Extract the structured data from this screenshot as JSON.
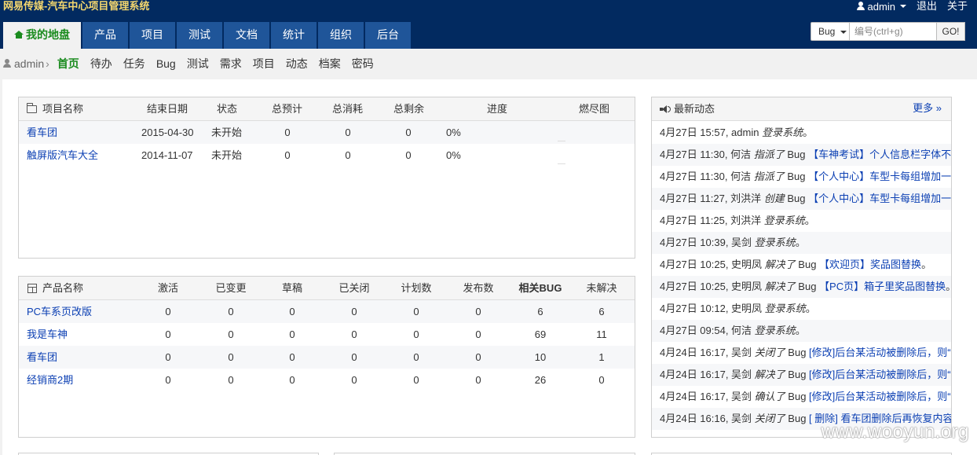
{
  "app_title": "网易传媒-汽车中心项目管理系统",
  "top_right": {
    "user": "admin",
    "logout": "退出",
    "about": "关于"
  },
  "main_nav": [
    "我的地盘",
    "产品",
    "项目",
    "测试",
    "文档",
    "统计",
    "组织",
    "后台"
  ],
  "search": {
    "type": "Bug",
    "placeholder": "编号(ctrl+g)",
    "go": "GO!"
  },
  "sub_nav": {
    "user": "admin",
    "items": [
      "首页",
      "待办",
      "任务",
      "Bug",
      "测试",
      "需求",
      "项目",
      "动态",
      "档案",
      "密码"
    ]
  },
  "project_panel": {
    "headers": [
      "项目名称",
      "结束日期",
      "状态",
      "总预计",
      "总消耗",
      "总剩余",
      "进度",
      "燃尽图"
    ],
    "rows": [
      {
        "name": "看车团",
        "end": "2015-04-30",
        "status": "未开始",
        "estimate": "0",
        "consumed": "0",
        "left": "0",
        "progress": "0%"
      },
      {
        "name": "触屏版汽车大全",
        "end": "2014-11-07",
        "status": "未开始",
        "estimate": "0",
        "consumed": "0",
        "left": "0",
        "progress": "0%"
      }
    ]
  },
  "product_panel": {
    "headers": [
      "产品名称",
      "激活",
      "已变更",
      "草稿",
      "已关闭",
      "计划数",
      "发布数",
      "相关BUG",
      "未解决"
    ],
    "rows": [
      {
        "name": "PC车系页改版",
        "vals": [
          "0",
          "0",
          "0",
          "0",
          "0",
          "0",
          "6",
          "6"
        ]
      },
      {
        "name": "我是车神",
        "vals": [
          "0",
          "0",
          "0",
          "0",
          "0",
          "0",
          "69",
          "11"
        ]
      },
      {
        "name": "看车团",
        "vals": [
          "0",
          "0",
          "0",
          "0",
          "0",
          "0",
          "10",
          "1"
        ]
      },
      {
        "name": "经销商2期",
        "vals": [
          "0",
          "0",
          "0",
          "0",
          "0",
          "0",
          "26",
          "0"
        ]
      }
    ]
  },
  "dynamic_panel": {
    "title": "最新动态",
    "more": "更多",
    "items": [
      {
        "prefix": "4月27日 15:57, admin ",
        "verb": "登录系统",
        "obj": "",
        "link": "",
        "suffix": "。"
      },
      {
        "prefix": "4月27日 11:30, 何洁 ",
        "verb": "指派了",
        "obj": " Bug ",
        "link": "【车神考试】个人信息栏字体不",
        "suffix": ""
      },
      {
        "prefix": "4月27日 11:30, 何洁 ",
        "verb": "指派了",
        "obj": " Bug ",
        "link": "【个人中心】车型卡每组增加一",
        "suffix": ""
      },
      {
        "prefix": "4月27日 11:27, 刘洪洋 ",
        "verb": "创建",
        "obj": " Bug ",
        "link": "【个人中心】车型卡每组增加一",
        "suffix": ""
      },
      {
        "prefix": "4月27日 11:25, 刘洪洋 ",
        "verb": "登录系统",
        "obj": "",
        "link": "",
        "suffix": "。"
      },
      {
        "prefix": "4月27日 10:39, 吴剑 ",
        "verb": "登录系统",
        "obj": "",
        "link": "",
        "suffix": "。"
      },
      {
        "prefix": "4月27日 10:25, 史明凤 ",
        "verb": "解决了",
        "obj": " Bug ",
        "link": "【欢迎页】奖品图替换",
        "suffix": "。"
      },
      {
        "prefix": "4月27日 10:25, 史明凤 ",
        "verb": "解决了",
        "obj": " Bug ",
        "link": "【PC页】箱子里奖品图替换",
        "suffix": "。"
      },
      {
        "prefix": "4月27日 10:12, 史明凤 ",
        "verb": "登录系统",
        "obj": "",
        "link": "",
        "suffix": "。"
      },
      {
        "prefix": "4月27日 09:54, 何洁 ",
        "verb": "登录系统",
        "obj": "",
        "link": "",
        "suffix": "。"
      },
      {
        "prefix": "4月24日 16:17, 吴剑 ",
        "verb": "关闭了",
        "obj": " Bug ",
        "link": "[修改]后台某活动被删除后，则“",
        "suffix": ""
      },
      {
        "prefix": "4月24日 16:17, 吴剑 ",
        "verb": "解决了",
        "obj": " Bug ",
        "link": "[修改]后台某活动被删除后，则“",
        "suffix": ""
      },
      {
        "prefix": "4月24日 16:17, 吴剑 ",
        "verb": "确认了",
        "obj": " Bug ",
        "link": "[修改]后台某活动被删除后，则“",
        "suffix": ""
      },
      {
        "prefix": "4月24日 16:16, 吴剑 ",
        "verb": "关闭了",
        "obj": " Bug ",
        "link": "[ 删除] 看车团删除后再恢复内容",
        "suffix": ""
      }
    ]
  },
  "watermark": "www.wooyun.org"
}
